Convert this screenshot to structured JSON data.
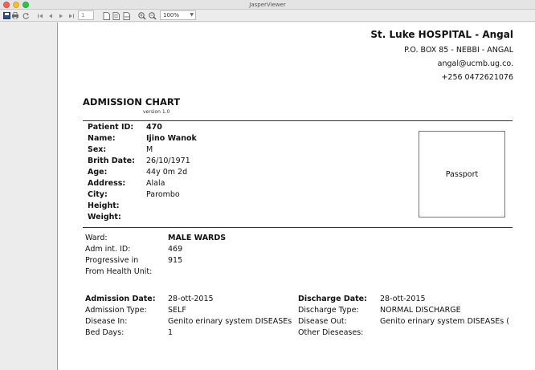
{
  "window": {
    "title": "JasperViewer"
  },
  "toolbar": {
    "page_value": "1",
    "zoom_value": "100%"
  },
  "hospital": {
    "name": "St. Luke HOSPITAL - Angal",
    "address": "P.O. BOX 85 - NEBBI - ANGAL",
    "email": "angal@ucmb.ug.co.",
    "phone": "+256 0472621076"
  },
  "document": {
    "title": "ADMISSION CHART",
    "version": "version 1.0"
  },
  "patient": {
    "id_label": "Patient ID:",
    "id_value": "470",
    "name_label": "Name:",
    "name_value": "Ijino Wanok",
    "sex_label": "Sex:",
    "sex_value": "M",
    "birth_label": "Brith Date:",
    "birth_value": "26/10/1971",
    "age_label": "Age:",
    "age_value": "44y 0m 2d",
    "address_label": "Address:",
    "address_value": "Alala",
    "city_label": "City:",
    "city_value": "Parombo",
    "height_label": "Height:",
    "weight_label": "Weight:"
  },
  "passport": {
    "label": "Passport"
  },
  "ward": {
    "ward_label": "Ward:",
    "ward_value": "MALE WARDS",
    "adm_label": "Adm int. ID:",
    "adm_value": "469",
    "prog_label": "Progressive in",
    "prog_value": "915",
    "from_label": "From Health Unit:"
  },
  "admission": {
    "date_label": "Admission Date:",
    "date_value": "28-ott-2015",
    "type_label": "Admission Type:",
    "type_value": "SELF",
    "disease_in_label": "Disease In:",
    "disease_in_value": "Genito erinary system DISEASEs",
    "bed_days_label": "Bed Days:",
    "bed_days_value": "1"
  },
  "discharge": {
    "date_label": "Discharge Date:",
    "date_value": "28-ott-2015",
    "type_label": "Discharge Type:",
    "type_value": "NORMAL DISCHARGE",
    "disease_out_label": "Disease Out:",
    "disease_out_value": "Genito erinary system DISEASEs (",
    "other_label": "Other Dieseases:"
  }
}
